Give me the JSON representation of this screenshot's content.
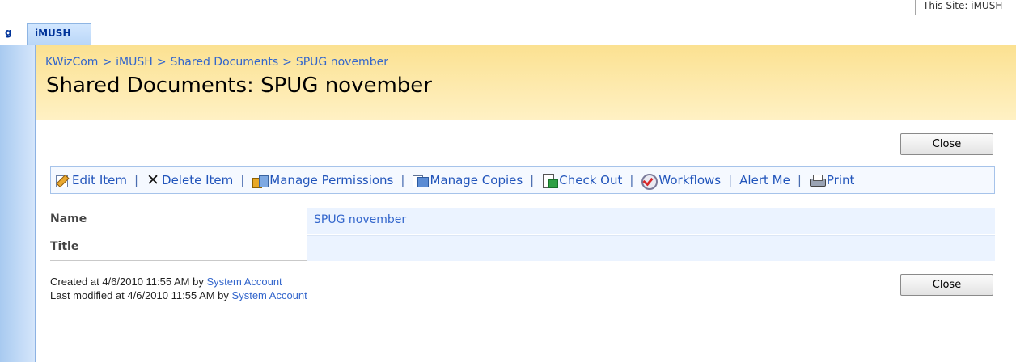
{
  "search_scope": "This Site: iMUSH",
  "tabs": [
    {
      "label": "g"
    },
    {
      "label": "iMUSH"
    }
  ],
  "breadcrumb": [
    "KWizCom",
    "iMUSH",
    "Shared Documents",
    "SPUG november"
  ],
  "breadcrumb_separator": ">",
  "page_title": "Shared Documents: SPUG november",
  "buttons": {
    "close_label": "Close"
  },
  "toolbar": {
    "items": [
      {
        "label": "Edit Item",
        "icon": "edit-item-icon"
      },
      {
        "label": "Delete Item",
        "icon": "delete-icon"
      },
      {
        "label": "Manage Permissions",
        "icon": "permissions-icon"
      },
      {
        "label": "Manage Copies",
        "icon": "copies-icon"
      },
      {
        "label": "Check Out",
        "icon": "check-out-icon"
      },
      {
        "label": "Workflows",
        "icon": "workflow-icon"
      },
      {
        "label": "Alert Me",
        "icon": null
      },
      {
        "label": "Print",
        "icon": "print-icon"
      }
    ],
    "separator": "|",
    "delete_glyph": "✕"
  },
  "fields": [
    {
      "label": "Name",
      "value": "SPUG november"
    },
    {
      "label": "Title",
      "value": ""
    }
  ],
  "meta": {
    "created_prefix": "Created at 4/6/2010 11:55 AM  by ",
    "created_by": "System Account",
    "modified_prefix": "Last modified at 4/6/2010 11:55 AM  by ",
    "modified_by": "System Account"
  },
  "colors": {
    "title_band": "#fbe191",
    "link": "#3366cc",
    "tab_active": "#b9d6f7",
    "field_value_bg": "#ebf3ff"
  }
}
